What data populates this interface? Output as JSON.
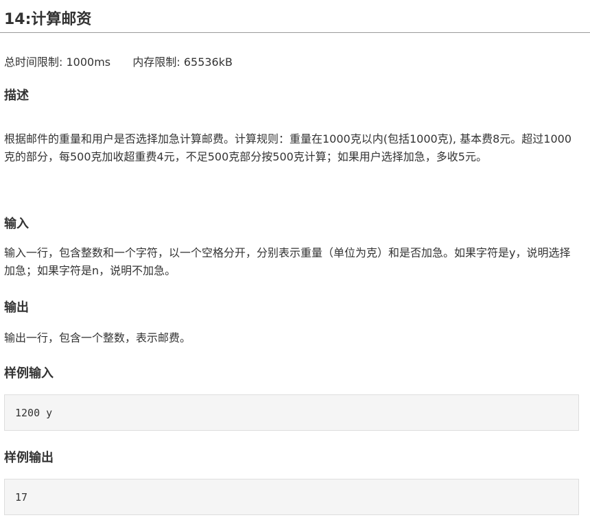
{
  "problem": {
    "title": "14:计算邮资",
    "limits": {
      "time_label": "总时间限制:",
      "time_value": "1000ms",
      "memory_label": "内存限制:",
      "memory_value": "65536kB"
    },
    "description": {
      "heading": "描述",
      "text": "根据邮件的重量和用户是否选择加急计算邮费。计算规则：重量在1000克以内(包括1000克), 基本费8元。超过1000克的部分，每500克加收超重费4元，不足500克部分按500克计算；如果用户选择加急，多收5元。"
    },
    "input": {
      "heading": "输入",
      "text": "输入一行，包含整数和一个字符，以一个空格分开，分别表示重量（单位为克）和是否加急。如果字符是y，说明选择加急；如果字符是n，说明不加急。"
    },
    "output": {
      "heading": "输出",
      "text": "输出一行，包含一个整数，表示邮费。"
    },
    "sample_input": {
      "heading": "样例输入",
      "text": "1200 y"
    },
    "sample_output": {
      "heading": "样例输出",
      "text": "17"
    }
  }
}
